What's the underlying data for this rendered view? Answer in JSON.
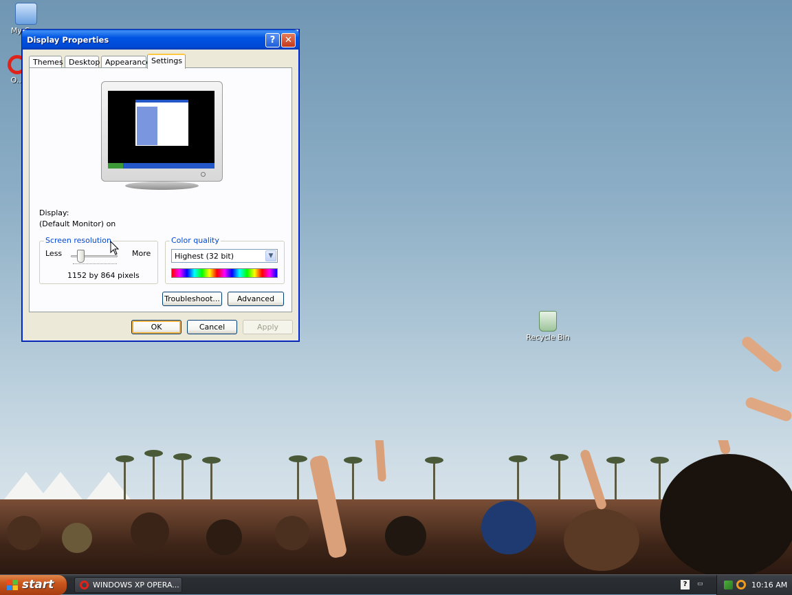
{
  "desktop": {
    "icons": [
      {
        "label": "My Co..."
      },
      {
        "label": "O..."
      },
      {
        "label": "Recycle Bin"
      }
    ]
  },
  "window": {
    "title": "Display Properties",
    "help_glyph": "?",
    "close_glyph": "✕",
    "tabs": [
      "Themes",
      "Desktop",
      "Appearance",
      "Settings"
    ],
    "active_tab": "Settings",
    "display_label": "Display:",
    "display_value": "(Default Monitor) on",
    "resolution": {
      "legend": "Screen resolution",
      "less": "Less",
      "more": "More",
      "value_text": "1152 by 864 pixels",
      "slider_fraction": 0.15
    },
    "color_quality": {
      "legend": "Color quality",
      "selected": "Highest (32 bit)"
    },
    "buttons": {
      "troubleshoot": "Troubleshoot...",
      "advanced": "Advanced",
      "ok": "OK",
      "cancel": "Cancel",
      "apply": "Apply"
    }
  },
  "taskbar": {
    "start_label": "start",
    "task_item": "WINDOWS XP OPERA...",
    "clock": "10:16 AM",
    "lang_glyph": "?"
  },
  "colors": {
    "titlebar": "#0054e3",
    "accent_legend": "#0046d5",
    "default_button_ring": "#f0b240"
  }
}
